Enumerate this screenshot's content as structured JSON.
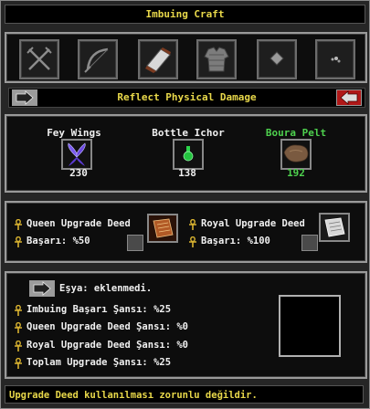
{
  "window": {
    "title": "Imbuing Craft"
  },
  "categories": [
    {
      "icon": "crossed-swords-icon"
    },
    {
      "icon": "bow-icon"
    },
    {
      "icon": "scroll-icon"
    },
    {
      "icon": "chainmail-icon"
    },
    {
      "icon": "gem-icon"
    },
    {
      "icon": "dots-icon"
    }
  ],
  "property": {
    "name": "Reflect Physical Damage"
  },
  "resources": [
    {
      "name": "Fey Wings",
      "count": "230",
      "color": "#f0f0f0"
    },
    {
      "name": "Bottle Ichor",
      "count": "138",
      "color": "#f0f0f0"
    },
    {
      "name": "Boura Pelt",
      "count": "192",
      "color": "#4ed14e"
    }
  ],
  "deeds": {
    "queen": {
      "label": "Queen Upgrade Deed",
      "chance": "Başarı: %50"
    },
    "royal": {
      "label": "Royal Upgrade Deed",
      "chance": "Başarı: %100"
    }
  },
  "item": {
    "label": "Eşya: eklenmedi."
  },
  "stats": [
    "Imbuing Başarı Şansı: %25",
    "Queen Upgrade Deed Şansı: %0",
    "Royal Upgrade Deed Şansı: %0",
    "Toplam Upgrade Şansı: %25"
  ],
  "status": {
    "message": "Upgrade Deed kullanılması zorunlu değildir."
  }
}
